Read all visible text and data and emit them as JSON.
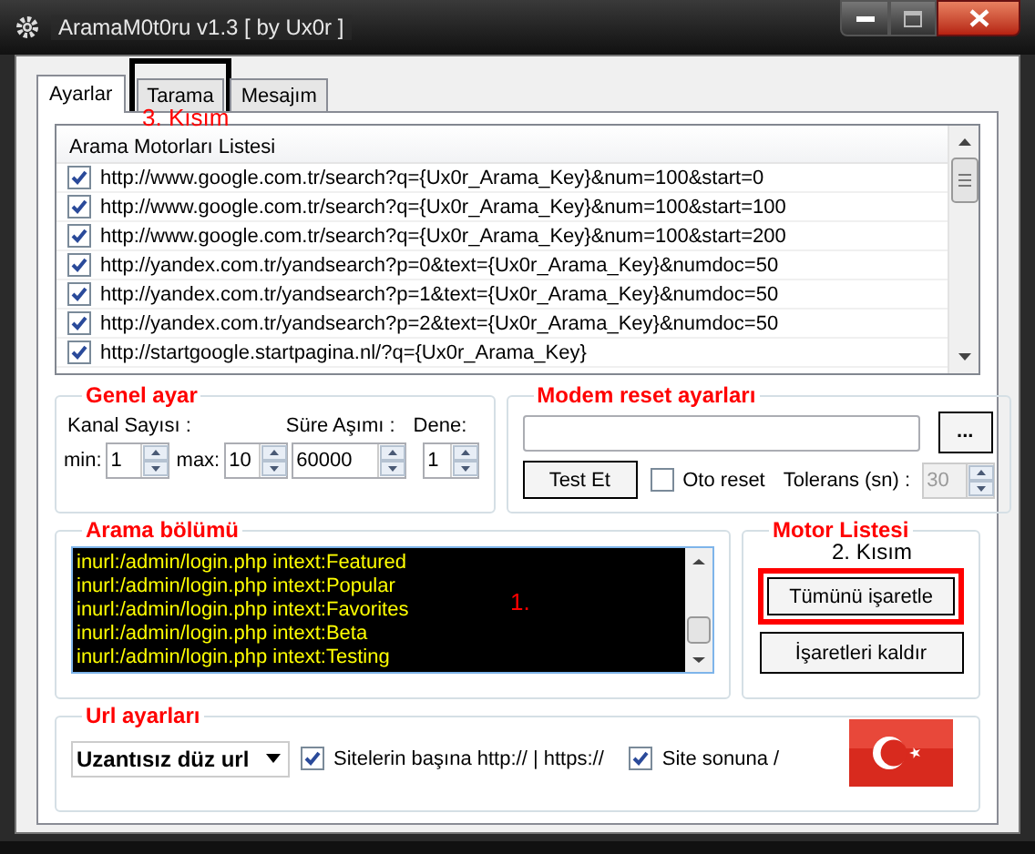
{
  "window": {
    "title": "AramaM0t0ru v1.3 [ by Ux0r ]"
  },
  "tabs": [
    {
      "label": "Ayarlar",
      "selected": true
    },
    {
      "label": "Tarama",
      "selected": false
    },
    {
      "label": "Mesajım",
      "selected": false
    }
  ],
  "engine_list": {
    "header": "Arama Motorları Listesi",
    "items": [
      {
        "url": "http://www.google.com.tr/search?q={Ux0r_Arama_Key}&num=100&start=0",
        "checked": true
      },
      {
        "url": "http://www.google.com.tr/search?q={Ux0r_Arama_Key}&num=100&start=100",
        "checked": true
      },
      {
        "url": "http://www.google.com.tr/search?q={Ux0r_Arama_Key}&num=100&start=200",
        "checked": true
      },
      {
        "url": "http://yandex.com.tr/yandsearch?p=0&text={Ux0r_Arama_Key}&numdoc=50",
        "checked": true
      },
      {
        "url": "http://yandex.com.tr/yandsearch?p=1&text={Ux0r_Arama_Key}&numdoc=50",
        "checked": true
      },
      {
        "url": "http://yandex.com.tr/yandsearch?p=2&text={Ux0r_Arama_Key}&numdoc=50",
        "checked": true
      },
      {
        "url": "http://startgoogle.startpagina.nl/?q={Ux0r_Arama_Key}",
        "checked": true
      }
    ]
  },
  "general": {
    "title": "Genel ayar",
    "channel_label": "Kanal Sayısı :",
    "timeout_label": "Süre Aşımı :",
    "retry_label": "Dene:",
    "min_label": "min:",
    "min": "1",
    "max_label": "max:",
    "max": "10",
    "timeout": "60000",
    "retry": "1"
  },
  "modem": {
    "title": "Modem reset ayarları",
    "browse_button": "...",
    "test_button": "Test Et",
    "auto_reset": {
      "label": "Oto reset",
      "checked": false
    },
    "tolerance_label": "Tolerans (sn) :",
    "tolerance": "30",
    "tolerance_disabled": true
  },
  "search": {
    "title": "Arama bölümü",
    "lines": [
      "inurl:/admin/login.php intext:Featured",
      "inurl:/admin/login.php intext:Popular",
      "inurl:/admin/login.php intext:Favorites",
      "inurl:/admin/login.php intext:Beta",
      "inurl:/admin/login.php intext:Testing"
    ]
  },
  "motor": {
    "title": "Motor Listesi",
    "buttons": [
      "Tümünü işaretle",
      "İşaretleri kaldır"
    ]
  },
  "url": {
    "title": "Url ayarları",
    "mode": "Uzantısız düz url",
    "options": [
      {
        "label": "Sitelerin başına http:// | https://",
        "checked": true
      },
      {
        "label": "Site sonuna /",
        "checked": true
      }
    ]
  },
  "annotations": [
    {
      "text": "3. Kısım"
    },
    {
      "text": "1."
    },
    {
      "text": "2. Kısım"
    }
  ]
}
